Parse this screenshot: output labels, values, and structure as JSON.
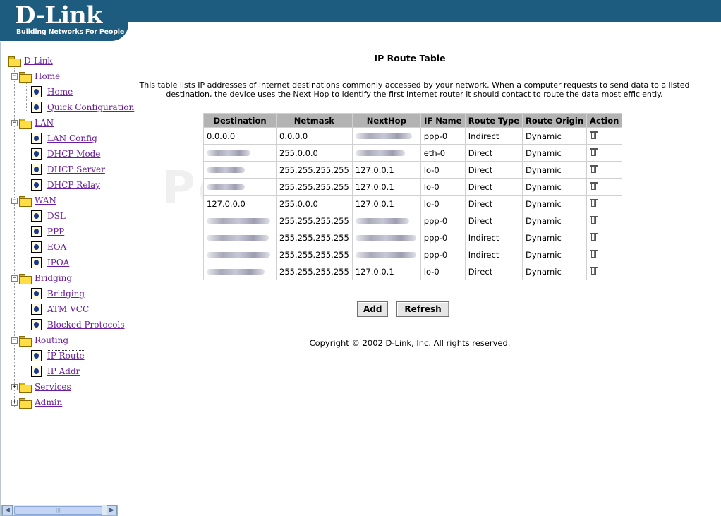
{
  "header": {
    "logo": "D-Link",
    "tagline": "Building Networks For People"
  },
  "sidebar": {
    "items": [
      {
        "label": "D-Link"
      },
      {
        "label": "Home"
      },
      {
        "label": "Home"
      },
      {
        "label": "Quick Configuration"
      },
      {
        "label": "LAN"
      },
      {
        "label": "LAN Config"
      },
      {
        "label": "DHCP Mode"
      },
      {
        "label": "DHCP Server"
      },
      {
        "label": "DHCP Relay"
      },
      {
        "label": "WAN"
      },
      {
        "label": "DSL"
      },
      {
        "label": "PPP"
      },
      {
        "label": "EOA"
      },
      {
        "label": "IPOA"
      },
      {
        "label": "Bridging"
      },
      {
        "label": "Bridging"
      },
      {
        "label": "ATM VCC"
      },
      {
        "label": "Blocked Protocols"
      },
      {
        "label": "Routing"
      },
      {
        "label": "IP Route"
      },
      {
        "label": "IP Addr"
      },
      {
        "label": "Services"
      },
      {
        "label": "Admin"
      }
    ]
  },
  "main": {
    "title": "IP Route Table",
    "description": "This table lists IP addresses of Internet destinations commonly accessed by your network. When a computer requests to send data to a listed destination, the device uses the Next Hop to identify the first Internet router it should contact to route the data most efficiently.",
    "columns": [
      "Destination",
      "Netmask",
      "NextHop",
      "IF Name",
      "Route Type",
      "Route Origin",
      "Action"
    ],
    "rows": [
      {
        "destination": "0.0.0.0",
        "netmask": "0.0.0.0",
        "nexthop": "",
        "ifname": "ppp-0",
        "type": "Indirect",
        "origin": "Dynamic"
      },
      {
        "destination": "",
        "netmask": "255.0.0.0",
        "nexthop": "",
        "ifname": "eth-0",
        "type": "Direct",
        "origin": "Dynamic"
      },
      {
        "destination": "",
        "netmask": "255.255.255.255",
        "nexthop": "127.0.0.1",
        "ifname": "lo-0",
        "type": "Direct",
        "origin": "Dynamic"
      },
      {
        "destination": "",
        "netmask": "255.255.255.255",
        "nexthop": "127.0.0.1",
        "ifname": "lo-0",
        "type": "Direct",
        "origin": "Dynamic"
      },
      {
        "destination": "127.0.0.0",
        "netmask": "255.0.0.0",
        "nexthop": "127.0.0.1",
        "ifname": "lo-0",
        "type": "Direct",
        "origin": "Dynamic"
      },
      {
        "destination": "",
        "netmask": "255.255.255.255",
        "nexthop": "",
        "ifname": "ppp-0",
        "type": "Direct",
        "origin": "Dynamic"
      },
      {
        "destination": "",
        "netmask": "255.255.255.255",
        "nexthop": "",
        "ifname": "ppp-0",
        "type": "Indirect",
        "origin": "Dynamic"
      },
      {
        "destination": "",
        "netmask": "255.255.255.255",
        "nexthop": "",
        "ifname": "ppp-0",
        "type": "Indirect",
        "origin": "Dynamic"
      },
      {
        "destination": "",
        "netmask": "255.255.255.255",
        "nexthop": "127.0.0.1",
        "ifname": "lo-0",
        "type": "Direct",
        "origin": "Dynamic"
      }
    ],
    "add_label": "Add",
    "refresh_label": "Refresh",
    "copyright": "Copyright © 2002 D-Link, Inc. All rights reserved.",
    "watermark": "PcWinTech.com"
  },
  "icons": {
    "folder": "folder-icon",
    "page": "page-icon",
    "delete": "trash-icon"
  },
  "colors": {
    "brand": "#1d5b7f",
    "link": "#6b1d9b",
    "header_cell": "#b3b3b3"
  }
}
